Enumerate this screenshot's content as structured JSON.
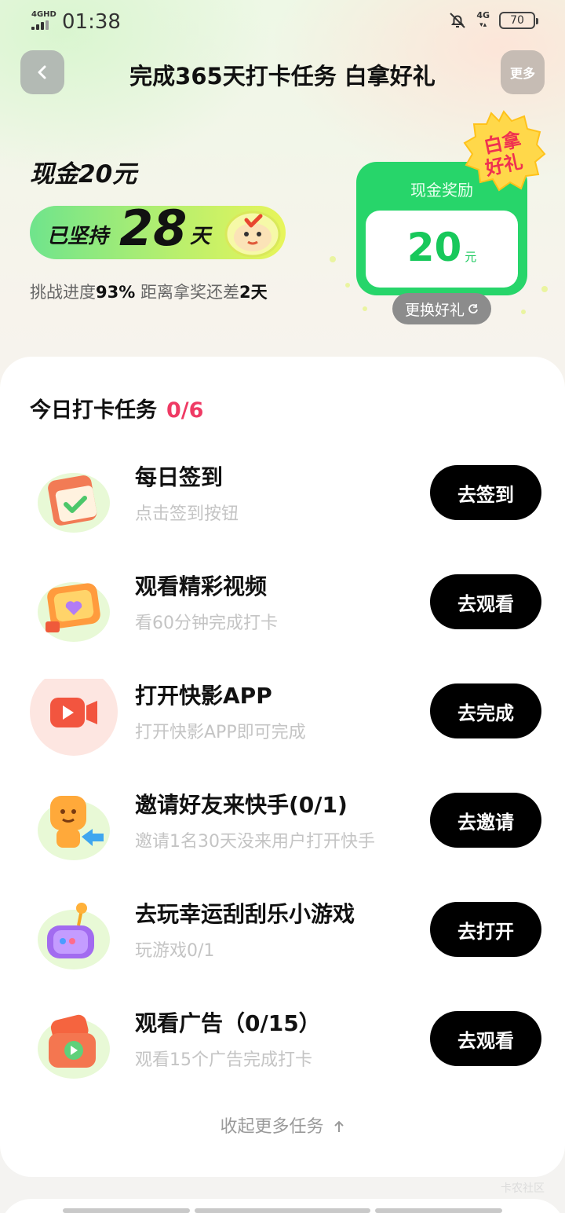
{
  "status_bar": {
    "network": "4GHD",
    "time": "01:38",
    "signal_right": "4G",
    "battery": "70"
  },
  "header": {
    "title": "完成365天打卡任务 白拿好礼",
    "more": "更多"
  },
  "hero": {
    "cash_title": "现金20元",
    "streak_prefix": "已坚持",
    "streak_days": "28",
    "streak_unit": "天",
    "progress_label": "挑战进度",
    "progress_percent": "93%",
    "remaining_label": "距离拿奖还差",
    "remaining_days": "2天",
    "reward_label": "现金奖励",
    "reward_amount": "20",
    "reward_unit": "元",
    "badge_line1": "白拿",
    "badge_line2": "好礼",
    "swap_label": "更换好礼"
  },
  "tasks_panel": {
    "title": "今日打卡任务",
    "count": "0/6",
    "collapse_label": "收起更多任务",
    "items": [
      {
        "title": "每日签到",
        "subtitle": "点击签到按钮",
        "button": "去签到",
        "icon": "calendar-check-icon"
      },
      {
        "title": "观看精彩视频",
        "subtitle": "看60分钟完成打卡",
        "button": "去观看",
        "icon": "video-heart-icon"
      },
      {
        "title": "打开快影APP",
        "subtitle": "打开快影APP即可完成",
        "button": "去完成",
        "icon": "kuaiying-camera-icon"
      },
      {
        "title": "邀请好友来快手(0/1)",
        "subtitle": "邀请1名30天没来用户打开快手",
        "button": "去邀请",
        "icon": "invite-friend-icon"
      },
      {
        "title": "去玩幸运刮刮乐小游戏",
        "subtitle": "玩游戏0/1",
        "button": "去打开",
        "icon": "game-joystick-icon"
      },
      {
        "title": "观看广告（0/15）",
        "subtitle": "观看15个广告完成打卡",
        "button": "去观看",
        "icon": "ad-play-icon"
      }
    ]
  },
  "colors": {
    "accent_green": "#27d56a",
    "count_red": "#ef3a64",
    "button_black": "#000000"
  },
  "watermark": "卡农社区"
}
